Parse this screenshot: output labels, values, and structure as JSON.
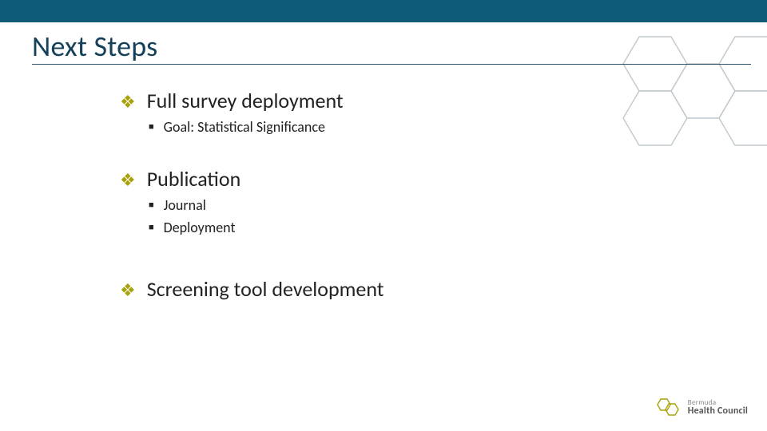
{
  "title": "Next Steps",
  "bullets": [
    {
      "label": "Full survey deployment",
      "sub": [
        "Goal: Statistical Significance"
      ]
    },
    {
      "label": "Publication",
      "sub": [
        "Journal",
        "Deployment"
      ]
    },
    {
      "label": "Screening tool development",
      "sub": []
    }
  ],
  "logo": {
    "line1": "Bermuda",
    "line2": "Health Council"
  },
  "colors": {
    "bar": "#0e5b77",
    "accent": "#a8a20a",
    "title": "#14405a"
  }
}
